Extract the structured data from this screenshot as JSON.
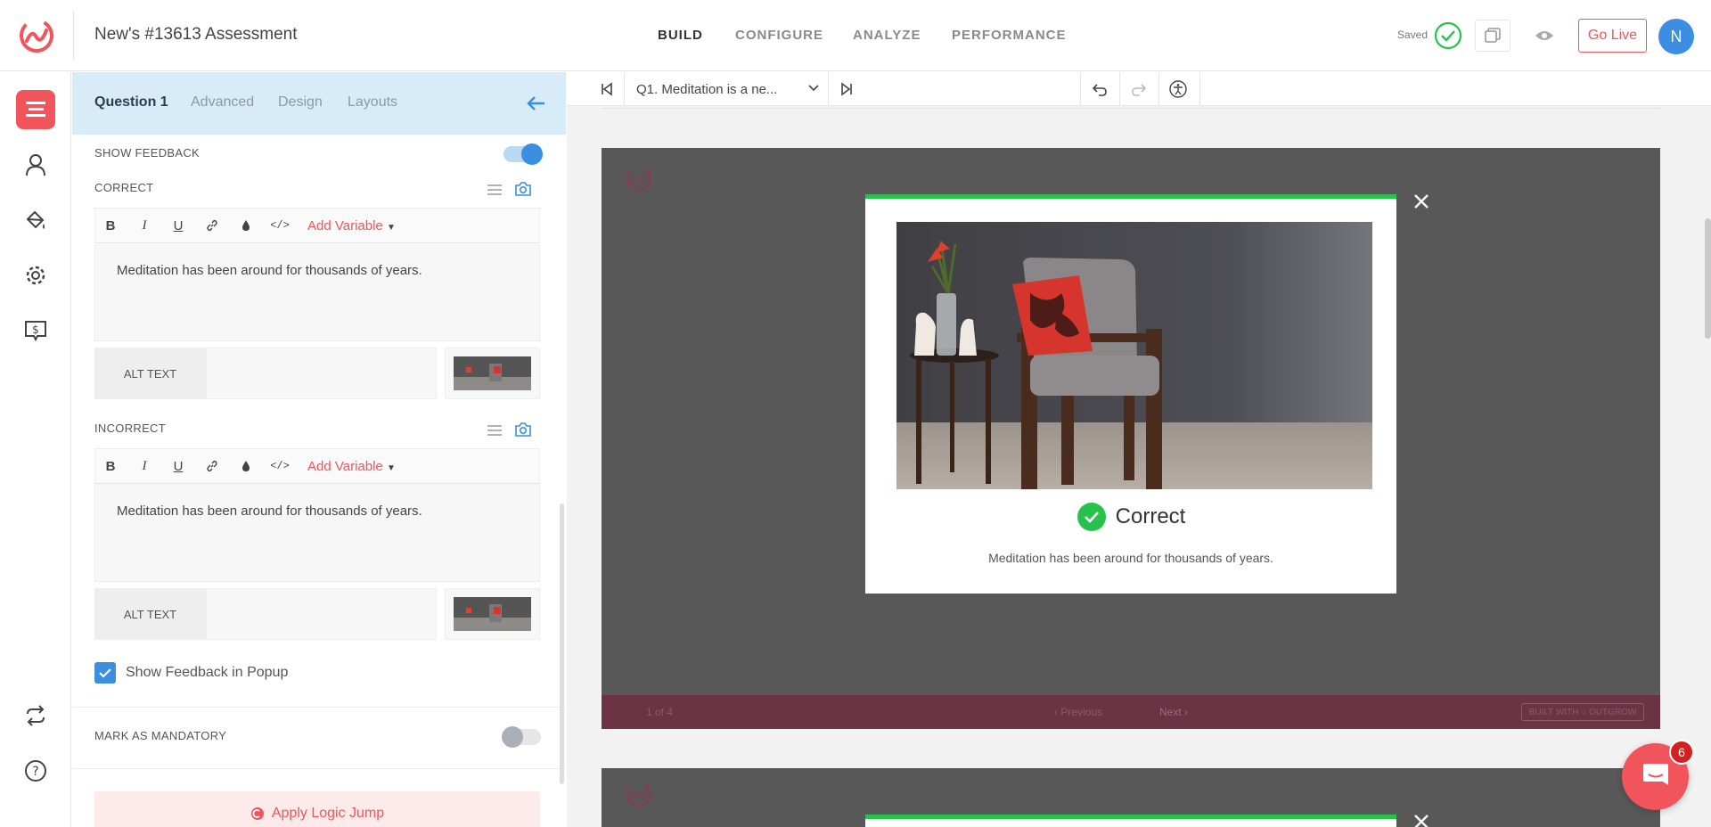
{
  "app": {
    "title": "New's #13613 Assessment",
    "nav": [
      "BUILD",
      "CONFIGURE",
      "ANALYZE",
      "PERFORMANCE"
    ],
    "saved_label": "Saved",
    "go_live_label": "Go Live",
    "avatar_initial": "N",
    "accent_color": "#f2545b"
  },
  "sidebar_icons": [
    "builder-icon",
    "user-icon",
    "paint-bucket-icon",
    "gear-icon",
    "billing-icon",
    "sync-icon",
    "help-icon"
  ],
  "panel": {
    "tabs": [
      "Question 1",
      "Advanced",
      "Design",
      "Layouts"
    ],
    "show_feedback_label": "SHOW FEEDBACK",
    "correct_label": "CORRECT",
    "incorrect_label": "INCORRECT",
    "add_variable_label": "Add Variable",
    "correct_text": "Meditation has been around for thousands of years.",
    "incorrect_text": "Meditation has been around for thousands of years.",
    "alt_text_label": "ALT TEXT",
    "show_feedback_popup_label": "Show Feedback in Popup",
    "mark_mandatory_label": "MARK AS MANDATORY",
    "apply_logic_label": "Apply Logic Jump",
    "show_feedback_on": true,
    "mandatory_on": false
  },
  "canvas": {
    "question_select": "Q1. Meditation is a ne...",
    "popup_title": "Correct",
    "popup_message": "Meditation has been around for thousands of years.",
    "page_indicator": "1 of 4",
    "prev_label": "Previous",
    "next_label": "Next",
    "built_with": "BUILT WITH",
    "built_brand": "OUTGROW"
  },
  "chat_badge_count": "6"
}
